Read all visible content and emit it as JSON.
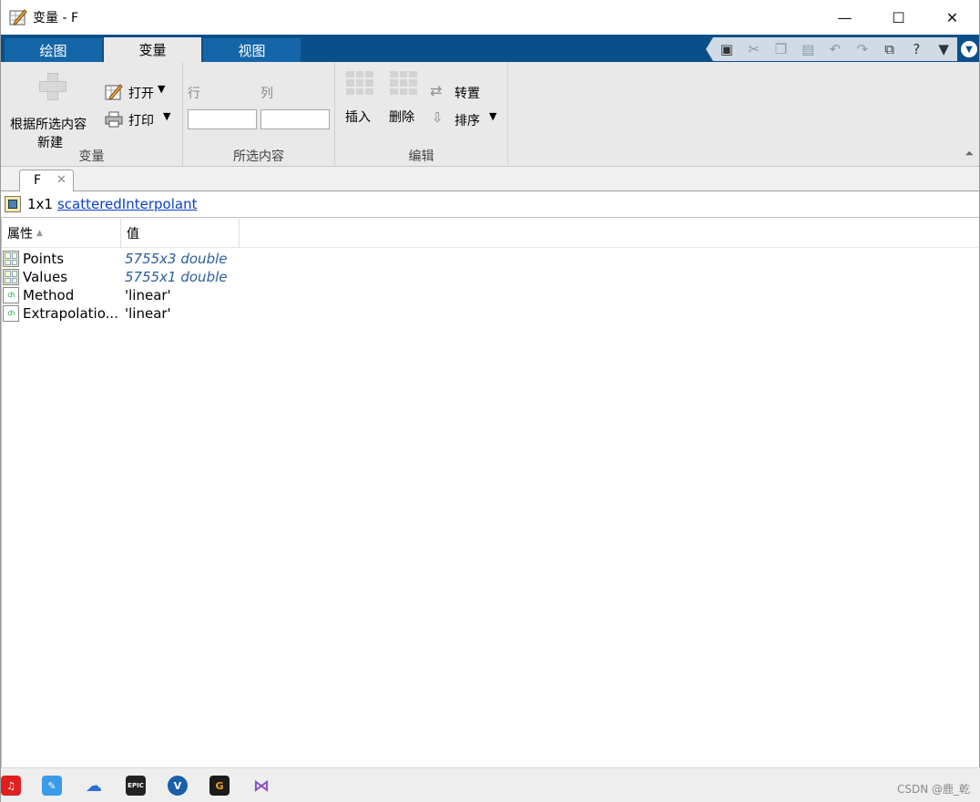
{
  "window": {
    "title": "变量 - F",
    "minimize": "—",
    "maximize": "☐",
    "close": "✕"
  },
  "ribbon_tabs": [
    {
      "label": "绘图"
    },
    {
      "label": "变量"
    },
    {
      "label": "视图"
    }
  ],
  "ribbon": {
    "variable_group": {
      "new_from_selection_line1": "根据所选内容",
      "new_from_selection_line2": "新建",
      "open_label": "打开",
      "print_label": "打印",
      "label": "变量"
    },
    "selection_group": {
      "row_label": "行",
      "col_label": "列",
      "row_value": "",
      "col_value": "",
      "label": "所选内容"
    },
    "edit_group": {
      "insert_label": "插入",
      "delete_label": "删除",
      "transpose_label": "转置",
      "sort_label": "排序",
      "label": "编辑"
    }
  },
  "document_tab": {
    "label": "F",
    "close": "✕"
  },
  "info": {
    "size": "1x1",
    "class_name": "scatteredInterpolant"
  },
  "table": {
    "headers": [
      "属性",
      "值"
    ],
    "rows": [
      {
        "name": "Points",
        "value": "5755x3 double",
        "kind": "matrix"
      },
      {
        "name": "Values",
        "value": "5755x1 double",
        "kind": "matrix"
      },
      {
        "name": "Method",
        "value": "'linear'",
        "kind": "char"
      },
      {
        "name": "Extrapolatio...",
        "value": "'linear'",
        "kind": "char"
      }
    ]
  },
  "taskbar": {
    "watermark": "CSDN @鹿_乾"
  },
  "colors": {
    "tab_strip": "#0b4f8a",
    "tab_inactive": "#1566a8",
    "ribbon_bg": "#e9e9e9",
    "link": "#0a3fc8",
    "value_link": "#2d5d9e"
  }
}
